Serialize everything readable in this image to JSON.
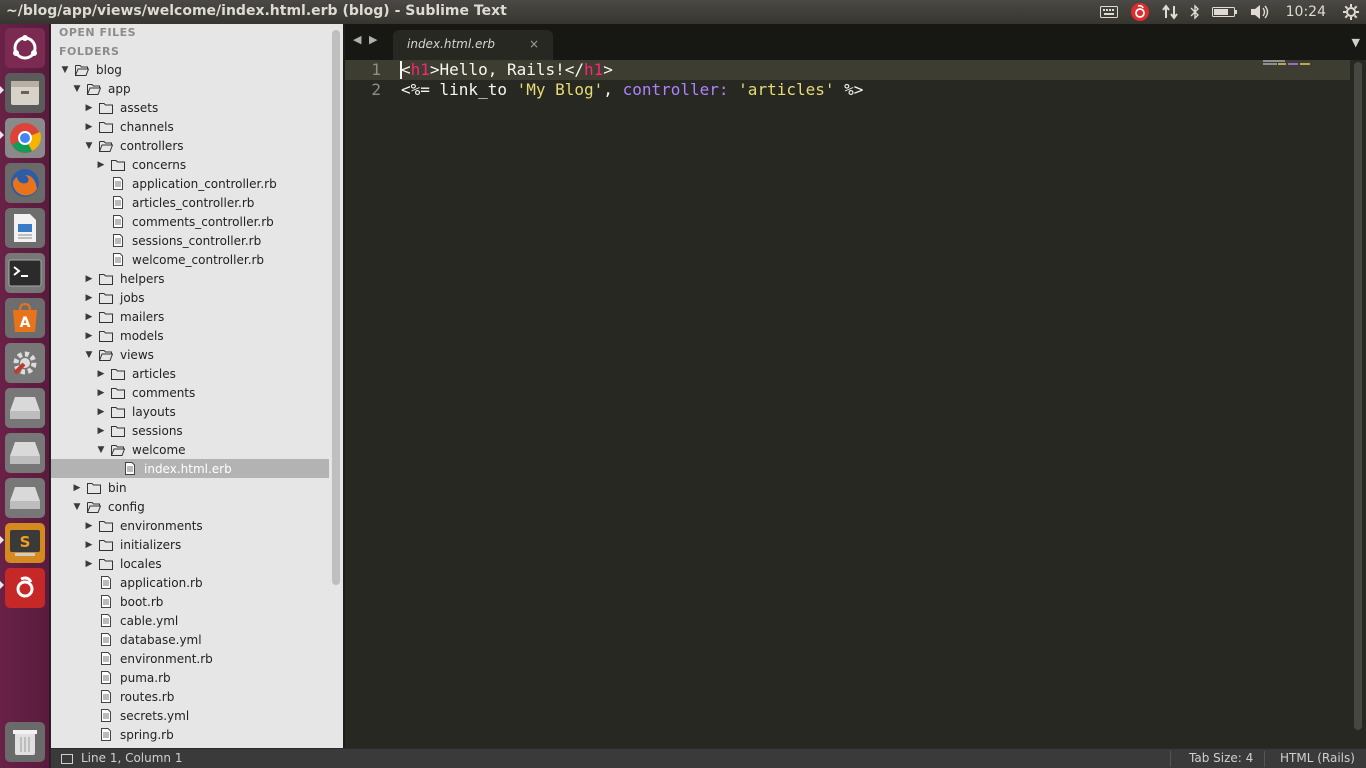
{
  "window": {
    "title": "~/blog/app/views/welcome/index.html.erb (blog) - Sublime Text"
  },
  "tray": {
    "clock": "10:24"
  },
  "launcher": {
    "items": [
      {
        "name": "dash-icon"
      },
      {
        "name": "files-icon"
      },
      {
        "name": "chrome-icon"
      },
      {
        "name": "firefox-icon"
      },
      {
        "name": "writer-icon"
      },
      {
        "name": "terminal-icon"
      },
      {
        "name": "software-center-icon"
      },
      {
        "name": "system-settings-icon"
      },
      {
        "name": "drive-icon"
      },
      {
        "name": "drive-icon"
      },
      {
        "name": "drive-icon"
      },
      {
        "name": "sublime-text-icon"
      },
      {
        "name": "netease-music-icon"
      },
      {
        "name": "trash-icon"
      }
    ]
  },
  "sidebar": {
    "open_files_header": "OPEN FILES",
    "folders_header": "FOLDERS",
    "tree": [
      {
        "label": "blog",
        "depth": 0,
        "kind": "folder",
        "expanded": true
      },
      {
        "label": "app",
        "depth": 1,
        "kind": "folder",
        "expanded": true
      },
      {
        "label": "assets",
        "depth": 2,
        "kind": "folder",
        "expanded": false
      },
      {
        "label": "channels",
        "depth": 2,
        "kind": "folder",
        "expanded": false
      },
      {
        "label": "controllers",
        "depth": 2,
        "kind": "folder",
        "expanded": true
      },
      {
        "label": "concerns",
        "depth": 3,
        "kind": "folder",
        "expanded": false
      },
      {
        "label": "application_controller.rb",
        "depth": 3,
        "kind": "file"
      },
      {
        "label": "articles_controller.rb",
        "depth": 3,
        "kind": "file"
      },
      {
        "label": "comments_controller.rb",
        "depth": 3,
        "kind": "file"
      },
      {
        "label": "sessions_controller.rb",
        "depth": 3,
        "kind": "file"
      },
      {
        "label": "welcome_controller.rb",
        "depth": 3,
        "kind": "file"
      },
      {
        "label": "helpers",
        "depth": 2,
        "kind": "folder",
        "expanded": false
      },
      {
        "label": "jobs",
        "depth": 2,
        "kind": "folder",
        "expanded": false
      },
      {
        "label": "mailers",
        "depth": 2,
        "kind": "folder",
        "expanded": false
      },
      {
        "label": "models",
        "depth": 2,
        "kind": "folder",
        "expanded": false
      },
      {
        "label": "views",
        "depth": 2,
        "kind": "folder",
        "expanded": true
      },
      {
        "label": "articles",
        "depth": 3,
        "kind": "folder",
        "expanded": false
      },
      {
        "label": "comments",
        "depth": 3,
        "kind": "folder",
        "expanded": false
      },
      {
        "label": "layouts",
        "depth": 3,
        "kind": "folder",
        "expanded": false
      },
      {
        "label": "sessions",
        "depth": 3,
        "kind": "folder",
        "expanded": false
      },
      {
        "label": "welcome",
        "depth": 3,
        "kind": "folder",
        "expanded": true
      },
      {
        "label": "index.html.erb",
        "depth": 4,
        "kind": "file",
        "selected": true
      },
      {
        "label": "bin",
        "depth": 1,
        "kind": "folder",
        "expanded": false
      },
      {
        "label": "config",
        "depth": 1,
        "kind": "folder",
        "expanded": true
      },
      {
        "label": "environments",
        "depth": 2,
        "kind": "folder",
        "expanded": false
      },
      {
        "label": "initializers",
        "depth": 2,
        "kind": "folder",
        "expanded": false
      },
      {
        "label": "locales",
        "depth": 2,
        "kind": "folder",
        "expanded": false
      },
      {
        "label": "application.rb",
        "depth": 2,
        "kind": "file"
      },
      {
        "label": "boot.rb",
        "depth": 2,
        "kind": "file"
      },
      {
        "label": "cable.yml",
        "depth": 2,
        "kind": "file"
      },
      {
        "label": "database.yml",
        "depth": 2,
        "kind": "file"
      },
      {
        "label": "environment.rb",
        "depth": 2,
        "kind": "file"
      },
      {
        "label": "puma.rb",
        "depth": 2,
        "kind": "file"
      },
      {
        "label": "routes.rb",
        "depth": 2,
        "kind": "file"
      },
      {
        "label": "secrets.yml",
        "depth": 2,
        "kind": "file"
      },
      {
        "label": "spring.rb",
        "depth": 2,
        "kind": "file"
      }
    ]
  },
  "tabs": [
    {
      "label": "index.html.erb",
      "close": "×",
      "active": true
    }
  ],
  "editor": {
    "lines": [
      {
        "num": "1",
        "tokens": [
          {
            "t": "<",
            "c": "plain"
          },
          {
            "t": "h1",
            "c": "tag"
          },
          {
            "t": ">Hello, Rails!</",
            "c": "plain"
          },
          {
            "t": "h1",
            "c": "tag"
          },
          {
            "t": ">",
            "c": "plain"
          }
        ]
      },
      {
        "num": "2",
        "tokens": [
          {
            "t": "<%= link_to ",
            "c": "plain"
          },
          {
            "t": "'My Blog'",
            "c": "str"
          },
          {
            "t": ", ",
            "c": "plain"
          },
          {
            "t": "controller:",
            "c": "kw"
          },
          {
            "t": " ",
            "c": "plain"
          },
          {
            "t": "'articles'",
            "c": "str"
          },
          {
            "t": " %>",
            "c": "plain"
          }
        ]
      }
    ],
    "colors": {
      "background": "#272822",
      "tag": "#f92672",
      "string": "#e6db74",
      "keyword": "#ae81ff",
      "plain": "#f8f8f2"
    }
  },
  "status": {
    "position": "Line 1, Column 1",
    "tab_size": "Tab Size: 4",
    "syntax": "HTML (Rails)"
  }
}
